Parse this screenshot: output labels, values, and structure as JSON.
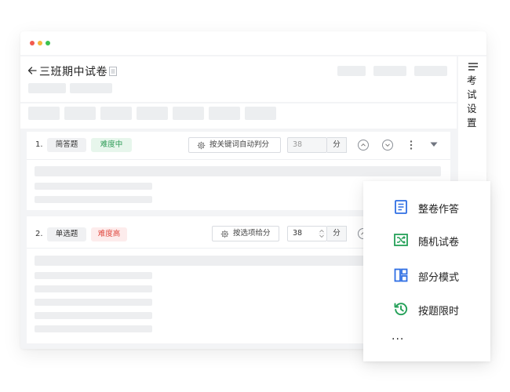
{
  "window": {
    "dot_colors": [
      "#f25a4e",
      "#f5b63b",
      "#3bc24f"
    ]
  },
  "header": {
    "back_icon": "arrow-left-icon",
    "title": "三班期中试卷",
    "title_icon": "document-icon"
  },
  "questions": [
    {
      "number": "1.",
      "type": "简答题",
      "difficulty": "难度中",
      "difficulty_color": "#2f9c57",
      "difficulty_bg": "#e7f6ec",
      "scoring_button": "按关键词自动判分",
      "score": "38",
      "score_unit": "分",
      "actions": [
        "move-up-icon",
        "move-down-icon",
        "more-vertical-icon",
        "collapse-triangle-icon"
      ]
    },
    {
      "number": "2.",
      "type": "单选题",
      "difficulty": "难度高",
      "difficulty_color": "#e0483f",
      "difficulty_bg": "#fdecec",
      "scoring_button": "按选项给分",
      "score": "38",
      "score_unit": "分",
      "actions": [
        "move-up-icon"
      ]
    }
  ],
  "side_tab": {
    "icon": "menu-lines-icon",
    "label": "考试设置"
  },
  "popup_menu": {
    "items": [
      {
        "label": "整卷作答",
        "icon": "paper-doc-icon",
        "color": "#2f6fe4"
      },
      {
        "label": "随机试卷",
        "icon": "shuffle-icon",
        "color": "#24a058"
      },
      {
        "label": "部分模式",
        "icon": "layout-icon",
        "color": "#2f6fe4"
      },
      {
        "label": "按题限时",
        "icon": "history-clock-icon",
        "color": "#24a058"
      }
    ],
    "more": "..."
  }
}
